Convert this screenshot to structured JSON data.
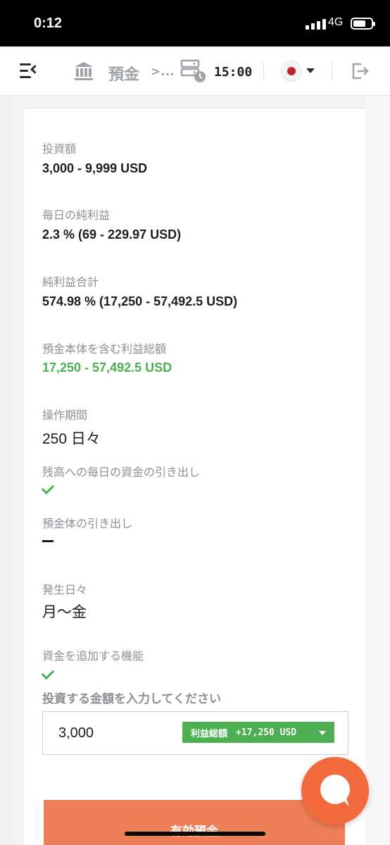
{
  "status_bar": {
    "time": "0:12",
    "network": "4G"
  },
  "nav": {
    "title": "預金",
    "breadcrumb_sep": ">...",
    "server_time": "15:00"
  },
  "fields": [
    {
      "label": "投資額",
      "value": "3,000 - 9,999 USD"
    },
    {
      "label": "毎日の純利益",
      "value": "2.3 % (69 - 229.97 USD)"
    },
    {
      "label": "純利益合計",
      "value": "574.98 % (17,250 - 57,492.5 USD)"
    },
    {
      "label": "預金本体を含む利益総額",
      "value": "17,250 - 57,492.5 USD"
    },
    {
      "label": "操作期間",
      "value": "250 日々"
    },
    {
      "label": "残高への毎日の資金の引き出し"
    },
    {
      "label": "預金体の引き出し"
    },
    {
      "label": "発生日々",
      "value": "月〜金"
    },
    {
      "label": "資金を追加する機能"
    }
  ],
  "amount_prompt": "投資する金額を入力してください",
  "amount_input": {
    "value": "3,000"
  },
  "profit_badge": {
    "label": "利益総額",
    "amount": "+17,250 USD"
  },
  "cta_label": "有効預金",
  "colors": {
    "accent": "#ef7f57",
    "fab": "#f26a3c",
    "success": "#4caf50"
  }
}
